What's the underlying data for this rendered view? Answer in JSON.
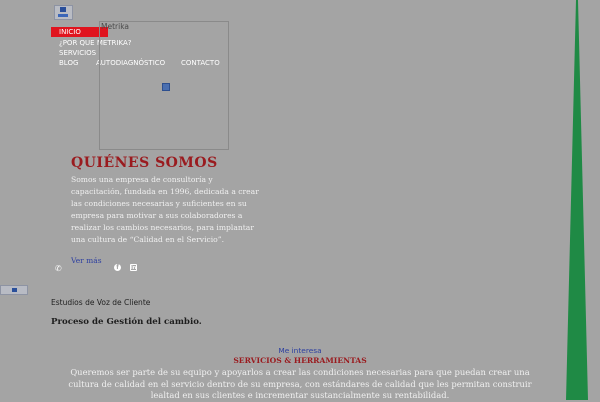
{
  "nav": {
    "items": [
      {
        "label": "INICIO",
        "active": true
      },
      {
        "label": "¿POR QUE METRIKA?"
      },
      {
        "label": "SERVICIOS"
      },
      {
        "label": "BLOG"
      },
      {
        "label": "AUTODIAGNÓSTICO"
      },
      {
        "label": "CONTACTO"
      }
    ]
  },
  "frame": {
    "title": "Metrika"
  },
  "about": {
    "heading": "QUIÉNES SOMOS",
    "paragraph": "Somos una empresa de consultoría y capacitación, fundada en 1996, dedicada a crear las condiciones necesarias y suficientes en su empresa para motivar a sus colaboradores a realizar los cambios necesarios, para implantar una cultura de “Calidad en el Servicio”.",
    "more_link": "Ver más"
  },
  "icons": {
    "phone": "phone-icon",
    "facebook": "facebook-icon",
    "linkedin": "linkedin-icon"
  },
  "sections": {
    "study": "Estudios de Voz de Cliente",
    "process": "Proceso de Gestión del cambio."
  },
  "services": {
    "interest_link": "Me interesa",
    "title": "SERVICIOS & HERRAMIENTAS",
    "description": "Queremos ser parte de su equipo y apoyarlos a crear las condiciones necesarias para que puedan crear una cultura de calidad en el servicio dentro de su empresa, con estándares de calidad que les permitan construir lealtad en sus clientes e incrementar sustancialmente su rentabilidad."
  },
  "colors": {
    "background": "#a4a4a4",
    "accent_red": "#e0141e",
    "heading_red": "#9a1b1f",
    "link_blue": "#2d3fa0",
    "brand_green": "#1f8a45"
  }
}
